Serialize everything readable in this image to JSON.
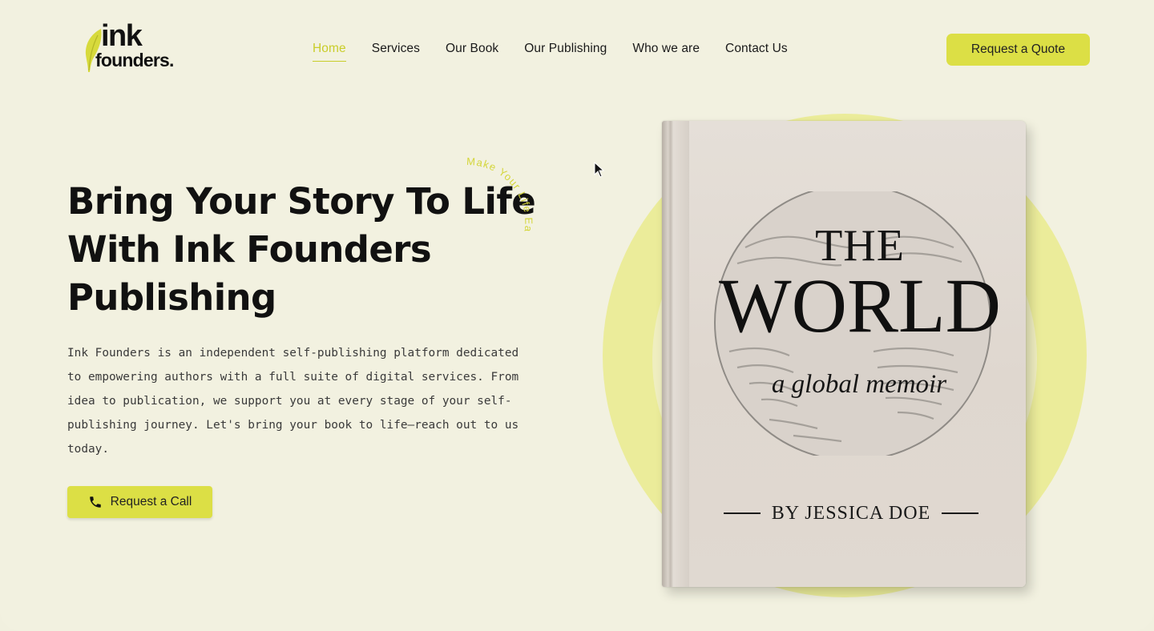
{
  "header": {
    "logo_line1": "ink",
    "logo_line2": "founders.",
    "nav": [
      {
        "label": "Home",
        "active": true
      },
      {
        "label": "Services",
        "active": false
      },
      {
        "label": "Our Book",
        "active": false
      },
      {
        "label": "Our Publishing",
        "active": false
      },
      {
        "label": "Who we are",
        "active": false
      },
      {
        "label": "Contact Us",
        "active": false
      }
    ],
    "cta_label": "Request a Quote"
  },
  "hero": {
    "title_line1": "Bring Your Story To Life",
    "title_line2": "With Ink Founders",
    "title_line3": "Publishing",
    "curved_tagline": "Make Your Life Easy",
    "description": "Ink Founders is an independent self-publishing platform dedicated to empowering authors with a full suite of digital services. From idea to publication, we support you at every stage of your self-publishing journey. Let's bring your book to life—reach out to us today.",
    "call_button_label": "Request a Call"
  },
  "book": {
    "title_small": "THE",
    "title_large": "WORLD",
    "subtitle": "a global memoir",
    "author": "BY JESSICA DOE"
  },
  "colors": {
    "background": "#f2f1e0",
    "accent": "#dcdf45",
    "accent_text": "#c9cd2a",
    "ring": "#ebec9a"
  },
  "icons": {
    "phone": "phone-icon",
    "cursor": "mouse-cursor-icon"
  }
}
